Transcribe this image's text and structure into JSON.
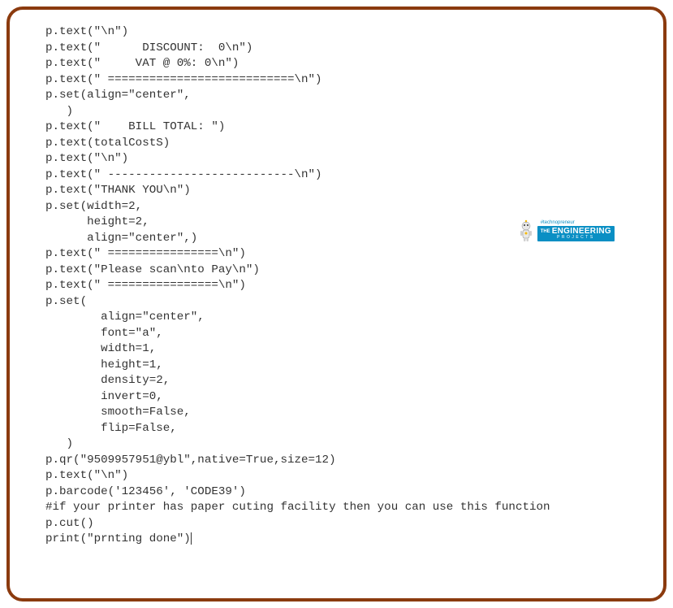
{
  "code": {
    "l1": "p.text(\"\\n\")",
    "l2": "p.text(\"      DISCOUNT:  0\\n\")",
    "l3": "p.text(\"     VAT @ 0%: 0\\n\")",
    "l4": "p.text(\" ===========================\\n\")",
    "l5": "p.set(align=\"center\",",
    "l6": "   )",
    "l7": "p.text(\"    BILL TOTAL: \")",
    "l8": "p.text(totalCostS)",
    "l9": "p.text(\"\\n\")",
    "l10": "p.text(\" ---------------------------\\n\")",
    "l11": "p.text(\"THANK YOU\\n\")",
    "l12": "p.set(width=2,",
    "l13": "      height=2,",
    "l14": "      align=\"center\",)",
    "l15": "p.text(\" ================\\n\")",
    "l16": "p.text(\"Please scan\\nto Pay\\n\")",
    "l17": "p.text(\" ================\\n\")",
    "l18": "p.set(",
    "l19": "        align=\"center\",",
    "l20": "        font=\"a\",",
    "l21": "        width=1,",
    "l22": "        height=1,",
    "l23": "        density=2,",
    "l24": "        invert=0,",
    "l25": "        smooth=False,",
    "l26": "        flip=False,",
    "l27": "   )",
    "l28": "p.qr(\"9509957951@ybl\",native=True,size=12)",
    "l29": "p.text(\"\\n\")",
    "l30": "p.barcode('123456', 'CODE39')",
    "l31": "#if your printer has paper cuting facility then you can use this function",
    "l32": "p.cut()",
    "l33": "print(\"prnting done\")"
  },
  "badge": {
    "tag": "#technopreneur",
    "the": "THE",
    "eng": "ENGINEERING",
    "proj": "PROJECTS"
  }
}
